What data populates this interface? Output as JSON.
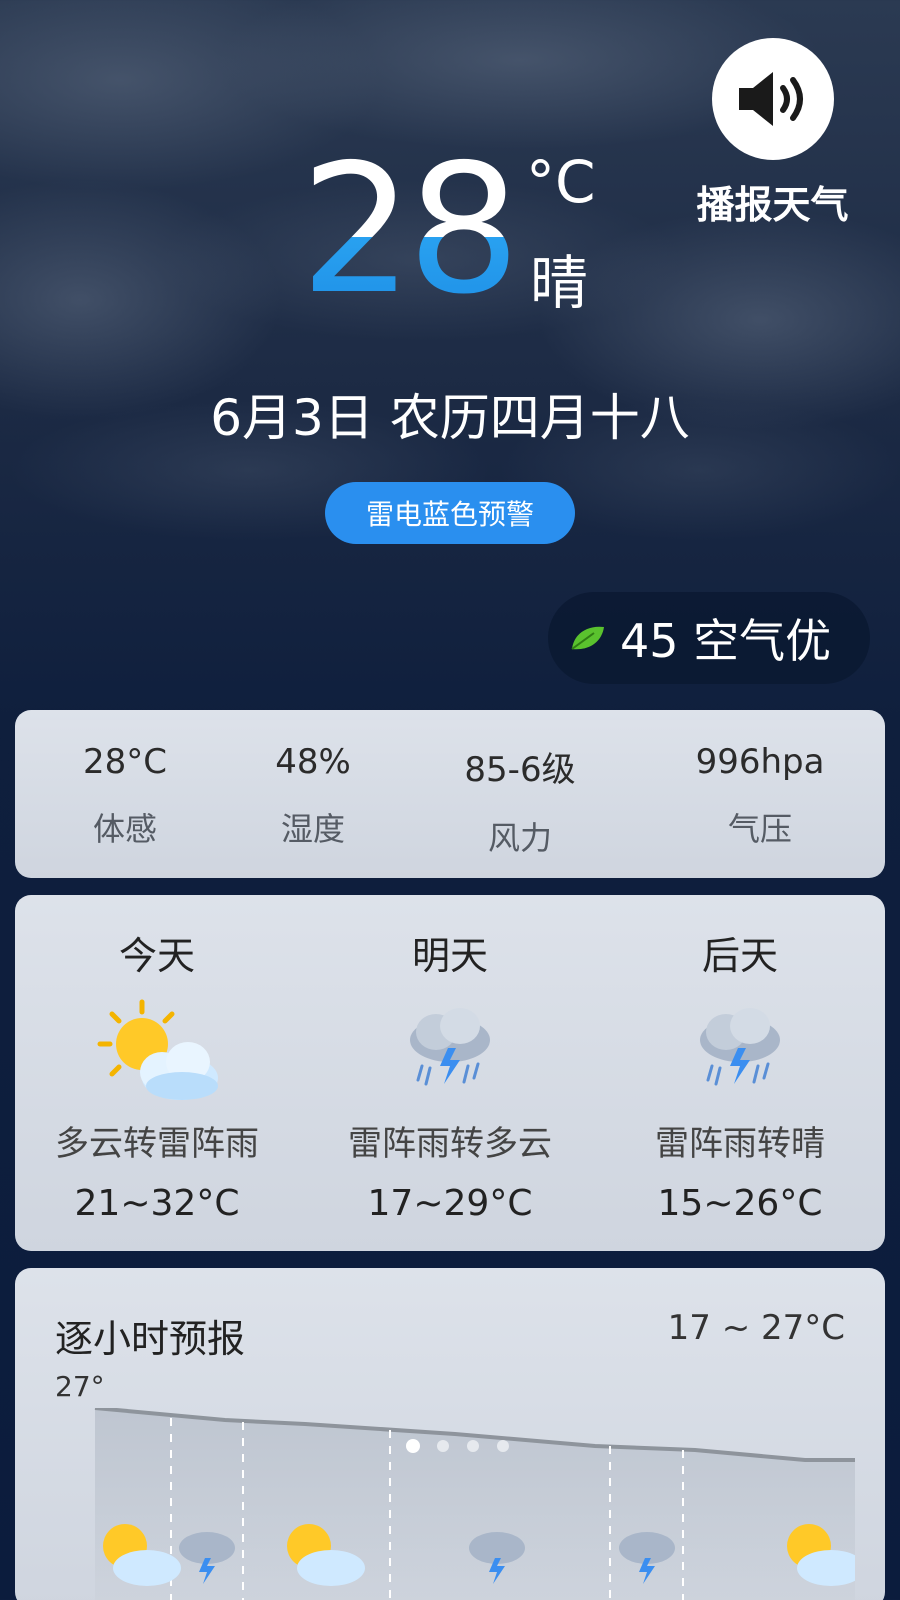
{
  "current": {
    "temp": "28",
    "unit": "°C",
    "condition": "晴"
  },
  "broadcast": {
    "label": "播报天气"
  },
  "date_line": "6月3日 农历四月十八",
  "alert": "雷电蓝色预警",
  "aqi": {
    "text": "45 空气优"
  },
  "stats": [
    {
      "value": "28°C",
      "label": "体感"
    },
    {
      "value": "48%",
      "label": "湿度"
    },
    {
      "value": "85-6级",
      "label": "风力"
    },
    {
      "value": "996hpa",
      "label": "气压"
    }
  ],
  "days": [
    {
      "name": "今天",
      "icon": "partly-cloudy-sun-icon",
      "desc": "多云转雷阵雨",
      "range": "21~32°C"
    },
    {
      "name": "明天",
      "icon": "thunderstorm-icon",
      "desc": "雷阵雨转多云",
      "range": "17~29°C"
    },
    {
      "name": "后天",
      "icon": "thunderstorm-icon",
      "desc": "雷阵雨转晴",
      "range": "15~26°C"
    }
  ],
  "hourly": {
    "title": "逐小时预报",
    "range": "17 ~ 27°C",
    "max_label": "27°"
  },
  "colors": {
    "accent": "#2a8fef",
    "temp_blue": "#1e8fe6",
    "leaf": "#5ac22e"
  }
}
